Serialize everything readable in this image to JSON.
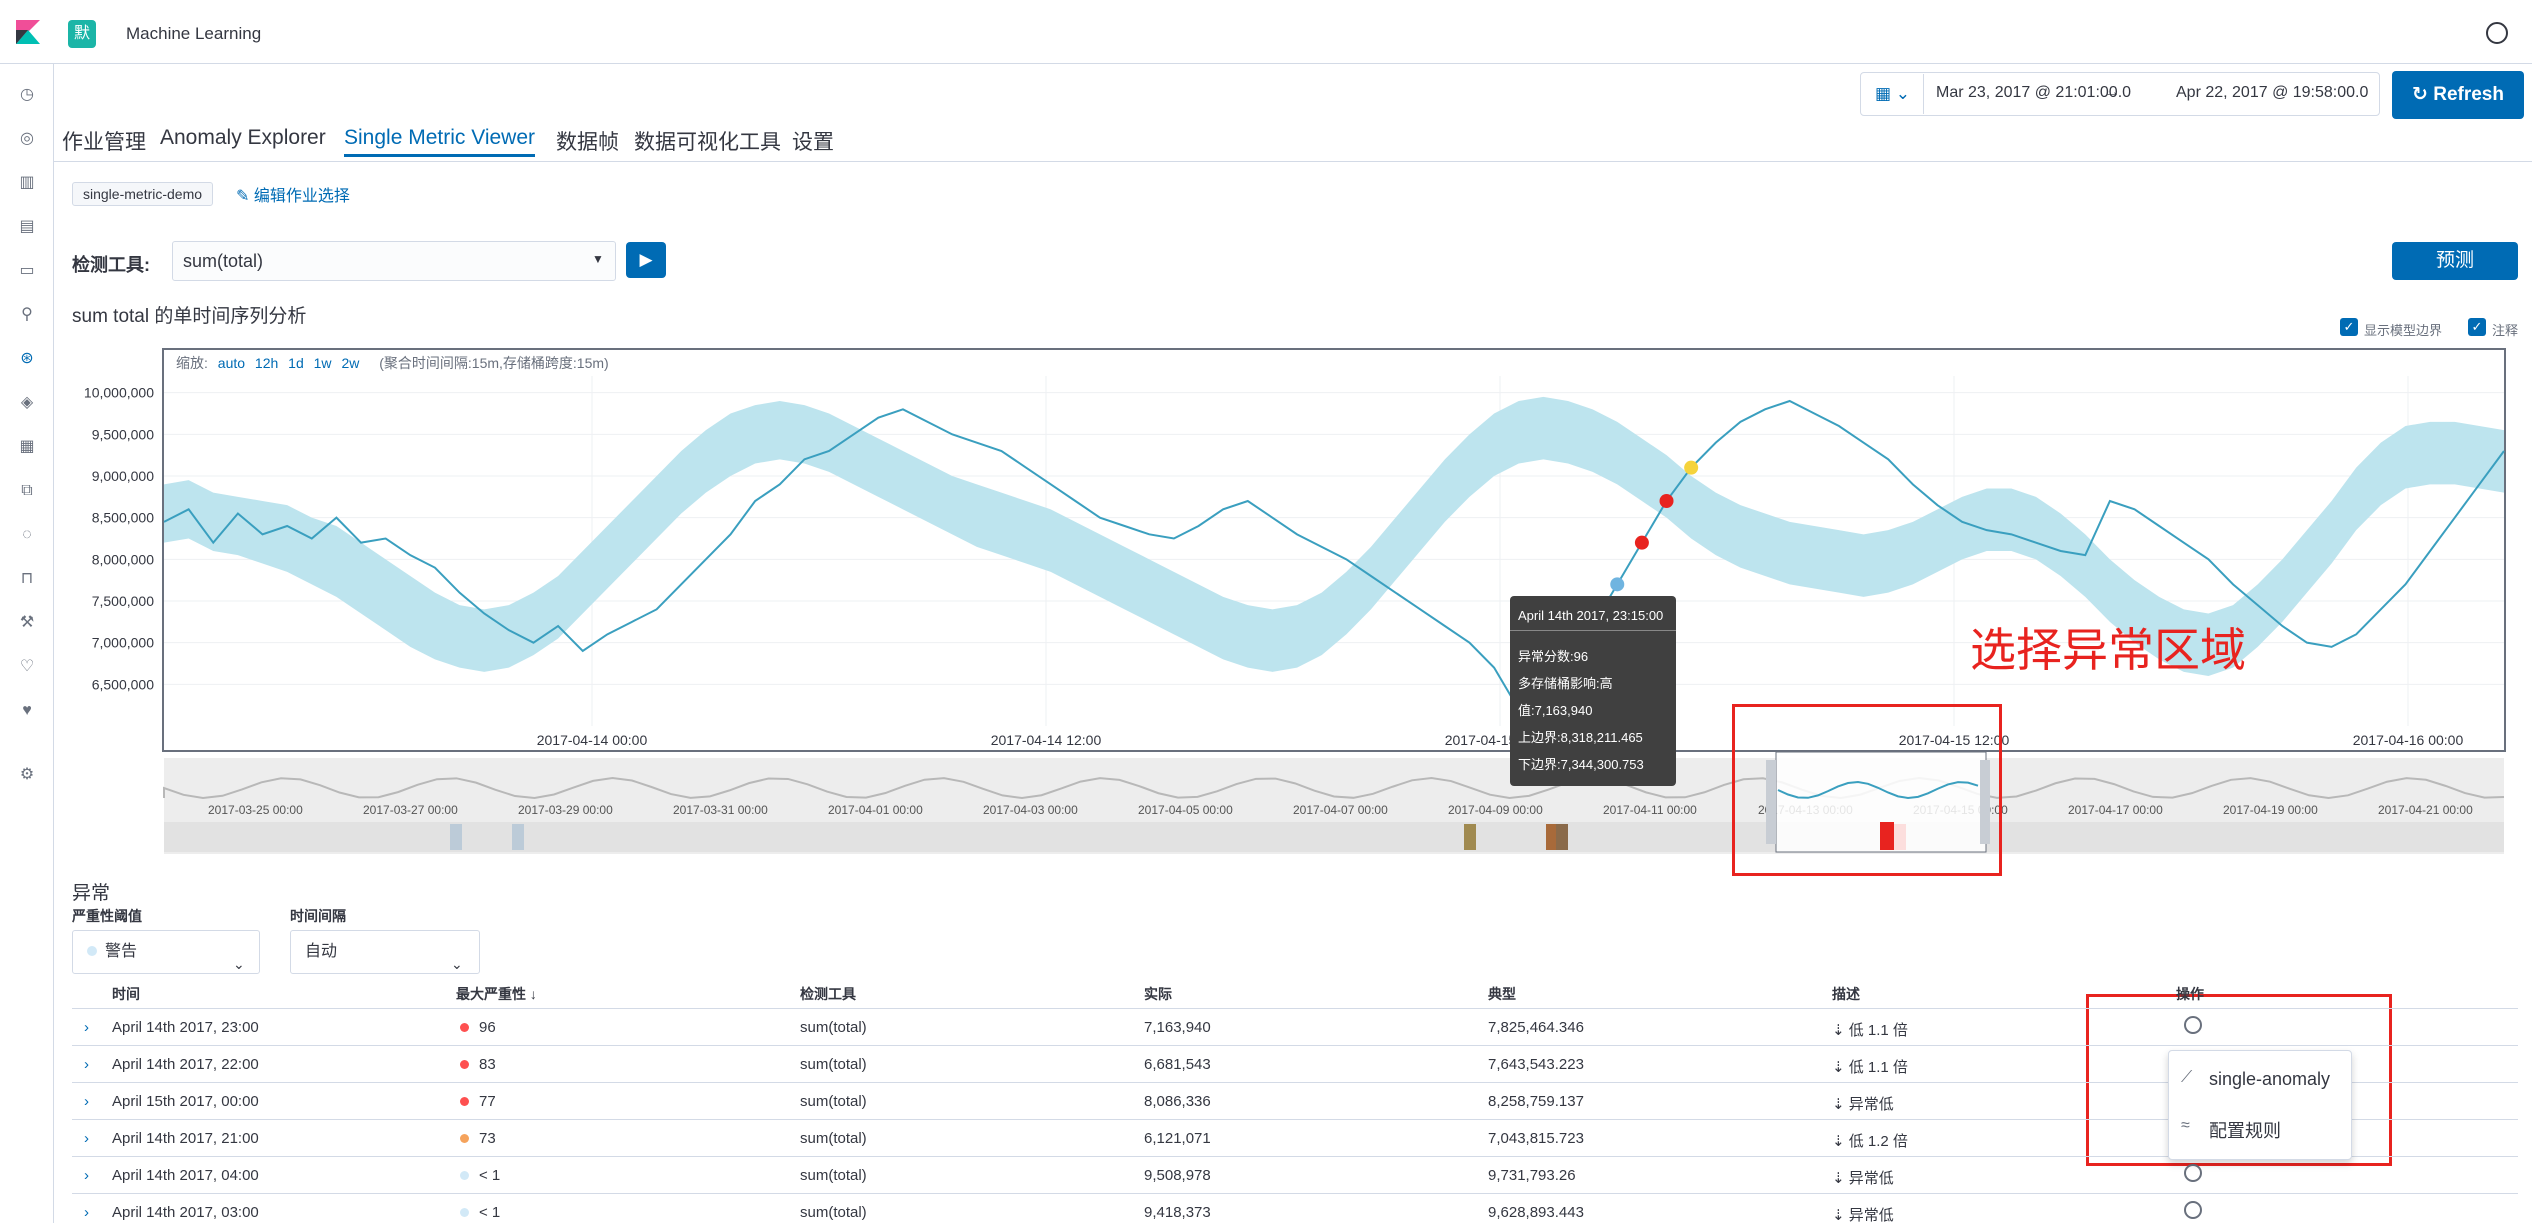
{
  "header": {
    "app_title": "Machine Learning",
    "space_initial": "默"
  },
  "timepicker": {
    "from": "Mar 23, 2017 @ 21:01:00.0",
    "arrow": "→",
    "to": "Apr 22, 2017 @ 19:58:00.0",
    "refresh": "Refresh"
  },
  "tabs": [
    "作业管理",
    "Anomaly Explorer",
    "Single Metric Viewer",
    "数据帧",
    "数据可视化工具",
    "设置"
  ],
  "job": {
    "badge": "single-metric-demo",
    "edit": "编辑作业选择"
  },
  "detector": {
    "label": "检测工具:",
    "value": "sum(total)",
    "forecast": "预测"
  },
  "chart_title": "sum total 的单时间序列分析",
  "toggles": {
    "model_bounds": "显示模型边界",
    "annotations": "注释"
  },
  "zoom": {
    "label": "缩放:",
    "options": [
      "auto",
      "12h",
      "1d",
      "1w",
      "2w"
    ],
    "note": "(聚合时间间隔:15m,存储桶跨度:15m)"
  },
  "chart_data": {
    "type": "line",
    "xlabels": [
      "2017-04-14 00:00",
      "2017-04-14 12:00",
      "2017-04-15 00:00",
      "2017-04-15 12:00",
      "2017-04-16 00:00"
    ],
    "yticks": [
      "10,000,000",
      "9,500,000",
      "9,000,000",
      "8,500,000",
      "8,000,000",
      "7,500,000",
      "7,000,000",
      "6,500,000"
    ],
    "ylim": [
      6000000,
      10200000
    ],
    "actual": [
      8450000,
      8600000,
      8200000,
      8550000,
      8300000,
      8400000,
      8250000,
      8500000,
      8200000,
      8250000,
      8050000,
      7900000,
      7600000,
      7350000,
      7150000,
      7000000,
      7200000,
      6900000,
      7100000,
      7250000,
      7400000,
      7700000,
      8000000,
      8300000,
      8700000,
      8900000,
      9200000,
      9300000,
      9500000,
      9700000,
      9800000,
      9650000,
      9500000,
      9400000,
      9300000,
      9100000,
      8900000,
      8700000,
      8500000,
      8400000,
      8300000,
      8250000,
      8400000,
      8600000,
      8700000,
      8500000,
      8300000,
      8150000,
      8000000,
      7800000,
      7600000,
      7400000,
      7200000,
      7000000,
      6700000,
      6200000,
      6450000,
      6800000,
      7200000,
      7700000,
      8200000,
      8700000,
      9100000,
      9400000,
      9650000,
      9800000,
      9900000,
      9750000,
      9600000,
      9400000,
      9200000,
      8900000,
      8650000,
      8450000,
      8350000,
      8300000,
      8200000,
      8100000,
      8050000,
      8700000,
      8600000,
      8400000,
      8200000,
      8000000,
      7700000,
      7450000,
      7200000,
      7000000,
      6950000,
      7100000,
      7400000,
      7700000,
      8100000,
      8500000,
      8900000,
      9300000
    ],
    "upper": [
      8900000,
      8950000,
      8800000,
      8750000,
      8700000,
      8650000,
      8500000,
      8400000,
      8200000,
      8000000,
      7800000,
      7600000,
      7450000,
      7400000,
      7450000,
      7600000,
      7800000,
      8100000,
      8400000,
      8700000,
      9000000,
      9300000,
      9550000,
      9750000,
      9850000,
      9900000,
      9850000,
      9750000,
      9600000,
      9450000,
      9300000,
      9150000,
      9000000,
      8900000,
      8800000,
      8700000,
      8600000,
      8450000,
      8300000,
      8150000,
      8000000,
      7850000,
      7700000,
      7550000,
      7450000,
      7400000,
      7450000,
      7600000,
      7850000,
      8150000,
      8500000,
      8850000,
      9200000,
      9500000,
      9750000,
      9900000,
      9950000,
      9900000,
      9800000,
      9650000,
      9450000,
      9250000,
      9000000,
      8800000,
      8650000,
      8550000,
      8450000,
      8400000,
      8350000,
      8300000,
      8350000,
      8450000,
      8600000,
      8750000,
      8850000,
      8850000,
      8750000,
      8550000,
      8300000,
      8000000,
      7750000,
      7550000,
      7400000,
      7350000,
      7450000,
      7700000,
      8000000,
      8350000,
      8700000,
      9100000,
      9400000,
      9600000,
      9650000,
      9650000,
      9600000,
      9550000
    ],
    "lower": [
      8200000,
      8250000,
      8100000,
      8050000,
      7950000,
      7850000,
      7700000,
      7550000,
      7350000,
      7150000,
      6950000,
      6800000,
      6700000,
      6650000,
      6700000,
      6850000,
      7050000,
      7350000,
      7650000,
      7950000,
      8250000,
      8550000,
      8800000,
      9000000,
      9150000,
      9200000,
      9150000,
      9050000,
      8900000,
      8750000,
      8600000,
      8450000,
      8300000,
      8150000,
      8050000,
      7950000,
      7850000,
      7700000,
      7550000,
      7400000,
      7250000,
      7100000,
      6950000,
      6800000,
      6700000,
      6650000,
      6700000,
      6850000,
      7100000,
      7400000,
      7750000,
      8100000,
      8450000,
      8750000,
      9000000,
      9150000,
      9200000,
      9150000,
      9050000,
      8900000,
      8700000,
      8500000,
      8250000,
      8050000,
      7900000,
      7800000,
      7700000,
      7650000,
      7600000,
      7550000,
      7600000,
      7700000,
      7850000,
      8000000,
      8100000,
      8100000,
      8000000,
      7800000,
      7550000,
      7250000,
      7000000,
      6800000,
      6650000,
      6600000,
      6700000,
      6950000,
      7250000,
      7600000,
      7950000,
      8350000,
      8650000,
      8850000,
      8900000,
      8900000,
      8850000,
      8800000
    ]
  },
  "context": {
    "labels": [
      "2017-03-25 00:00",
      "2017-03-27 00:00",
      "2017-03-29 00:00",
      "2017-03-31 00:00",
      "2017-04-01 00:00",
      "2017-04-03 00:00",
      "2017-04-05 00:00",
      "2017-04-07 00:00",
      "2017-04-09 00:00",
      "2017-04-11 00:00",
      "2017-04-13 00:00",
      "2017-04-15 00:00",
      "2017-04-17 00:00",
      "2017-04-19 00:00",
      "2017-04-21 00:00"
    ]
  },
  "tooltip": {
    "title": "April 14th 2017, 23:15:00",
    "score": "异常分数:96",
    "impact": "多存储桶影响:高",
    "value": "值:7,163,940",
    "upper": "上边界:8,318,211.465",
    "lower": "下边界:7,344,300.753"
  },
  "annotation_text": "选择异常区域",
  "anomalies": {
    "title": "异常",
    "severity_label": "严重性阈值",
    "severity_value": "警告",
    "interval_label": "时间间隔",
    "interval_value": "自动",
    "columns": [
      "时间",
      "最大严重性",
      "检测工具",
      "实际",
      "典型",
      "描述",
      "操作"
    ],
    "sort_icon": "↓",
    "rows": [
      {
        "time": "April 14th 2017, 23:00",
        "sev": "96",
        "color": "#fe5050",
        "det": "sum(total)",
        "actual": "7,163,940",
        "typical": "7,825,464.346",
        "desc": "低 1.1 倍"
      },
      {
        "time": "April 14th 2017, 22:00",
        "sev": "83",
        "color": "#fe5050",
        "det": "sum(total)",
        "actual": "6,681,543",
        "typical": "7,643,543.223",
        "desc": "低 1.1 倍"
      },
      {
        "time": "April 15th 2017, 00:00",
        "sev": "77",
        "color": "#fe5050",
        "det": "sum(total)",
        "actual": "8,086,336",
        "typical": "8,258,759.137",
        "desc": "异常低"
      },
      {
        "time": "April 14th 2017, 21:00",
        "sev": "73",
        "color": "#f5a35c",
        "det": "sum(total)",
        "actual": "6,121,071",
        "typical": "7,043,815.723",
        "desc": "低 1.2 倍"
      },
      {
        "time": "April 14th 2017, 04:00",
        "sev": "< 1",
        "color": "#d2e9f7",
        "det": "sum(total)",
        "actual": "9,508,978",
        "typical": "9,731,793.26",
        "desc": "异常低"
      },
      {
        "time": "April 14th 2017, 03:00",
        "sev": "< 1",
        "color": "#d2e9f7",
        "det": "sum(total)",
        "actual": "9,418,373",
        "typical": "9,628,893.443",
        "desc": "异常低"
      }
    ],
    "menu": [
      "single-anomaly",
      "配置规则"
    ]
  }
}
